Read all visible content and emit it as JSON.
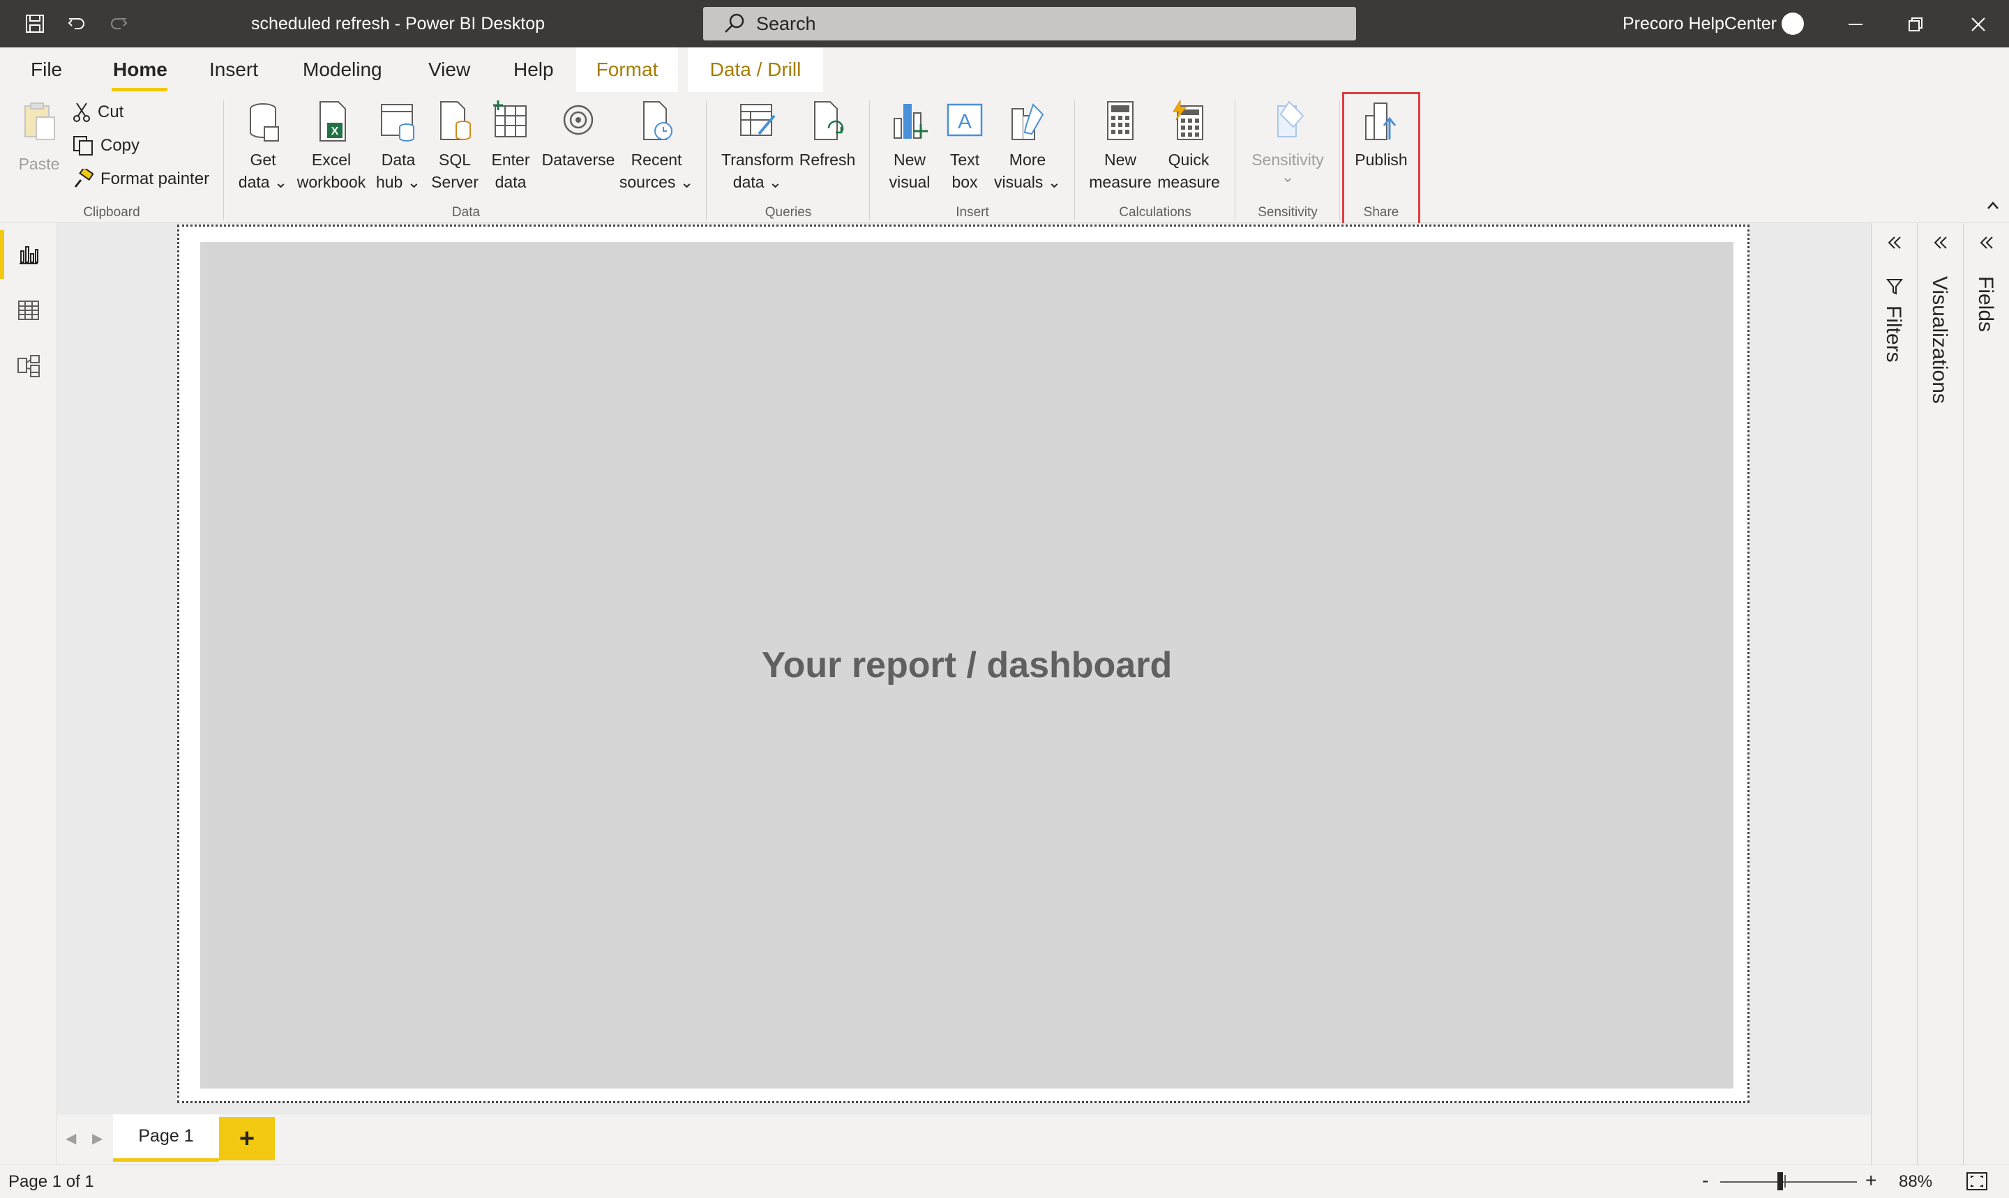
{
  "window": {
    "title": "scheduled refresh - Power BI Desktop",
    "search_placeholder": "Search",
    "user_name": "Precoro HelpCenter"
  },
  "menu_tabs": [
    {
      "label": "File"
    },
    {
      "label": "Home",
      "active": true
    },
    {
      "label": "Insert"
    },
    {
      "label": "Modeling"
    },
    {
      "label": "View"
    },
    {
      "label": "Help"
    },
    {
      "label": "Format",
      "contextual": true
    },
    {
      "label": "Data / Drill",
      "contextual": true
    }
  ],
  "ribbon": {
    "clipboard": {
      "paste": "Paste",
      "cut": "Cut",
      "copy": "Copy",
      "format_painter": "Format painter",
      "group": "Clipboard"
    },
    "data": {
      "get_data": [
        "Get",
        "data"
      ],
      "excel": [
        "Excel",
        "workbook"
      ],
      "data_hub": [
        "Data",
        "hub"
      ],
      "sql": [
        "SQL",
        "Server"
      ],
      "enter_data": [
        "Enter",
        "data"
      ],
      "dataverse": "Dataverse",
      "recent": [
        "Recent",
        "sources"
      ],
      "group": "Data"
    },
    "queries": {
      "transform": [
        "Transform",
        "data"
      ],
      "refresh": "Refresh",
      "group": "Queries"
    },
    "insert": {
      "new_visual": [
        "New",
        "visual"
      ],
      "text_box": [
        "Text",
        "box"
      ],
      "more_visuals": [
        "More",
        "visuals"
      ],
      "group": "Insert"
    },
    "calculations": {
      "new_measure": [
        "New",
        "measure"
      ],
      "quick_measure": [
        "Quick",
        "measure"
      ],
      "group": "Calculations"
    },
    "sensitivity": {
      "label": "Sensitivity",
      "group": "Sensitivity"
    },
    "share": {
      "publish": "Publish",
      "group": "Share"
    }
  },
  "canvas": {
    "placeholder": "Your report / dashboard"
  },
  "panes": {
    "filters": "Filters",
    "visualizations": "Visualizations",
    "fields": "Fields"
  },
  "pages": {
    "tab": "Page 1",
    "add": "+"
  },
  "status": {
    "page_info": "Page 1 of 1",
    "zoom": "88%",
    "zoom_minus": "-",
    "zoom_plus": "+"
  },
  "colors": {
    "accent": "#f2c811",
    "highlight": "#e03e3e",
    "titlebar": "#3b3a39"
  }
}
